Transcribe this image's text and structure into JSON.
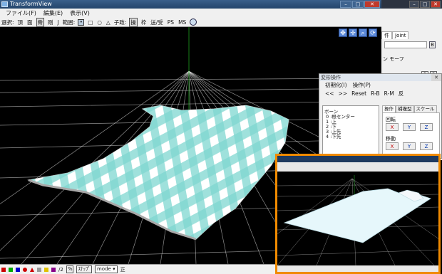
{
  "window": {
    "title": "TransformView"
  },
  "menu": [
    {
      "label": "ファイル(F)"
    },
    {
      "label": "編集(E)"
    },
    {
      "label": "表示(V)"
    }
  ],
  "toolbar": {
    "select_label": "選択:",
    "select_items": [
      "頂",
      "面",
      "骨",
      "剛",
      "J"
    ],
    "range_label": "範囲:",
    "range_shapes": [
      "•",
      "□",
      "○",
      "△"
    ],
    "child_label": "子政:",
    "child_items": [
      "操",
      "枠",
      "送/受",
      "PS",
      "MS"
    ]
  },
  "status": {
    "w_label": "/2",
    "pct_label": "%",
    "snap_label": "ｽﾅｯﾌﾟ",
    "mode_label": "mode",
    "mode_arrow": "▾",
    "direction_label": "正"
  },
  "bg_window": {
    "tabs": [
      "件",
      "Joint"
    ],
    "btn_a": "B",
    "label": "ン モーフ",
    "small_buttons": [
      "1",
      "2"
    ]
  },
  "panel": {
    "title": "変形操作",
    "menu": [
      "初期化(I)",
      "操作(P)"
    ],
    "buttons": [
      "<<",
      ">>",
      "Reset",
      "R-B",
      "R-M",
      "反"
    ],
    "bone_header": "ボーン",
    "bones": [
      "0 :根センター",
      "1 :上",
      "2 :下",
      "3 :上先",
      "4 :下先"
    ],
    "op_tabs": [
      "操作",
      "補複型",
      "スケール"
    ],
    "rotate_label": "回転",
    "move_label": "移動",
    "axes": [
      "X",
      "Y",
      "Z"
    ]
  },
  "colors": {
    "accent": "#f08a00",
    "cloth": "#7fd6d0",
    "grid": "#ffffff"
  }
}
